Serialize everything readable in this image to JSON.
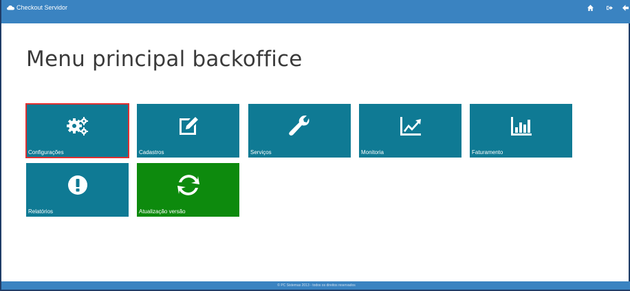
{
  "topbar": {
    "app_title": "Checkout Servidor",
    "icons": [
      "cloud-icon",
      "home-icon",
      "logout-icon",
      "back-arrow-icon"
    ]
  },
  "page": {
    "title": "Menu principal backoffice"
  },
  "tiles": [
    {
      "label": "Configurações",
      "icon": "gears-icon",
      "color": "#0f7a94",
      "selected": true
    },
    {
      "label": "Cadastros",
      "icon": "edit-icon",
      "color": "#0f7a94"
    },
    {
      "label": "Serviços",
      "icon": "wrench-icon",
      "color": "#0f7a94"
    },
    {
      "label": "Monitoria",
      "icon": "line-chart-icon",
      "color": "#0f7a94"
    },
    {
      "label": "Faturamento",
      "icon": "bar-chart-icon",
      "color": "#0f7a94"
    },
    {
      "label": "Relatórios",
      "icon": "exclamation-icon",
      "color": "#0f7a94"
    },
    {
      "label": "Atualização versão",
      "icon": "refresh-icon",
      "color": "#0d8a0d"
    }
  ],
  "footer": {
    "text": "© PC Sistemas 2013 - todos os direitos reservados"
  },
  "colors": {
    "topbar": "#3a83c1",
    "tile": "#0f7a94",
    "tile_green": "#0d8a0d",
    "selected_outline": "#e03030"
  }
}
